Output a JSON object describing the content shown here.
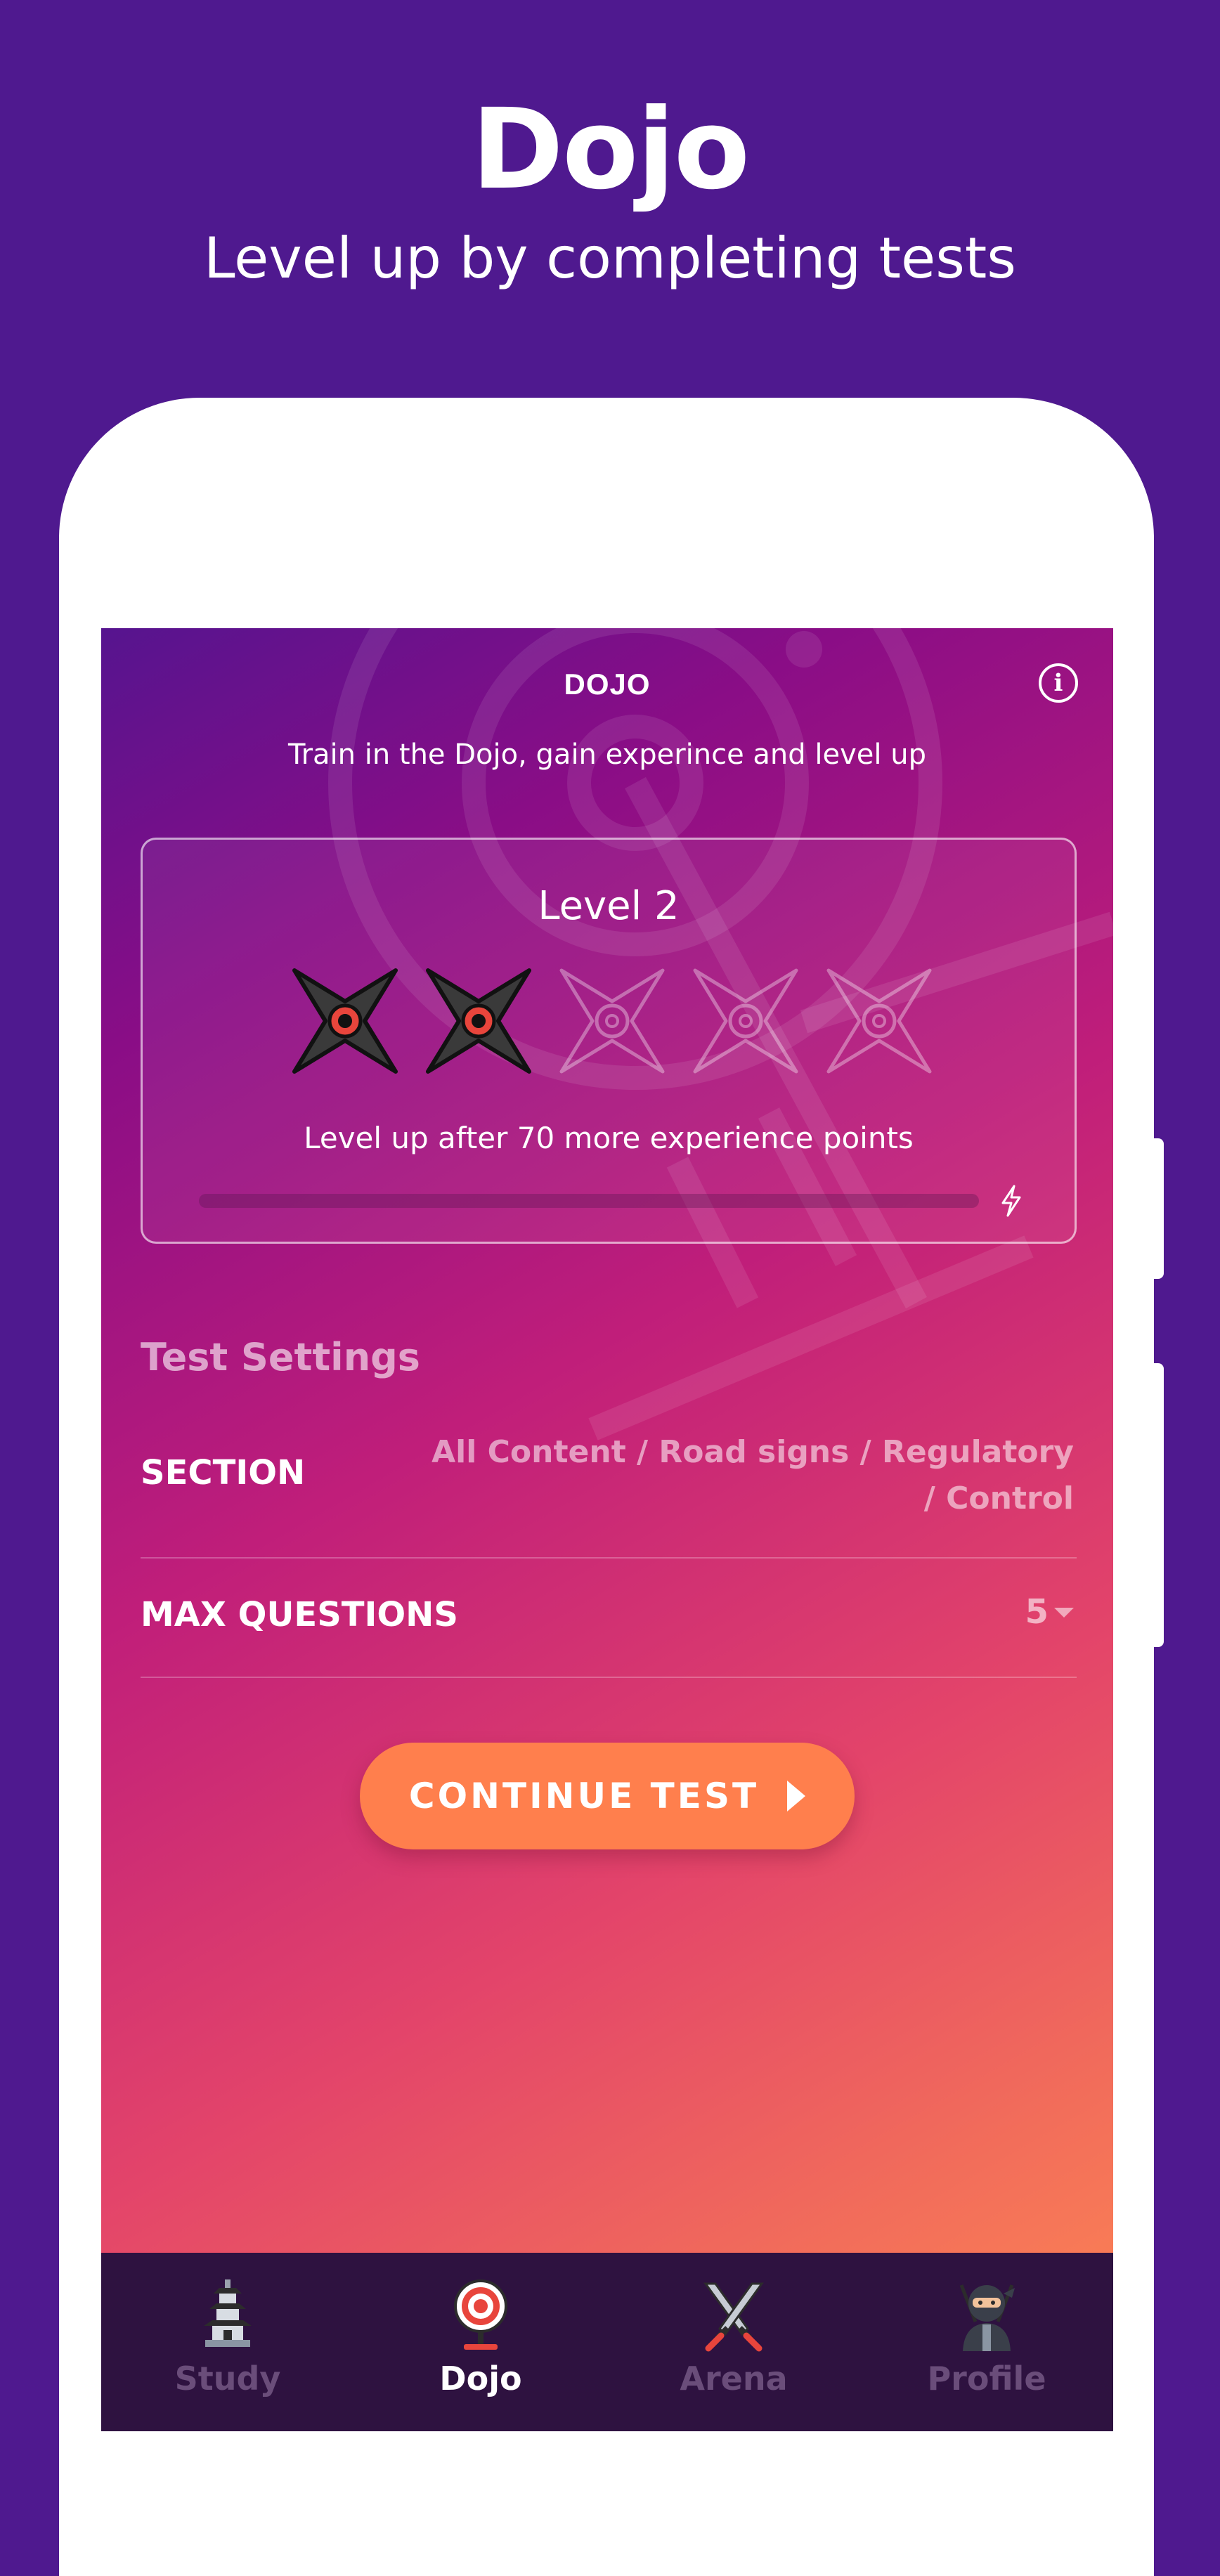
{
  "promo": {
    "title": "Dojo",
    "subtitle": "Level up by completing tests"
  },
  "screen": {
    "title": "DOJO",
    "info_icon": "info-icon",
    "subtitle": "Train in the Dojo, gain experince and level up"
  },
  "level_card": {
    "title": "Level 2",
    "stars_total": 5,
    "stars_earned": 2,
    "message": "Level up after 70 more experience points",
    "progress_fraction": 0.0
  },
  "settings": {
    "heading": "Test Settings",
    "section_label": "SECTION",
    "section_value": "All Content / Road signs / Regulatory / Control",
    "max_questions_label": "MAX QUESTIONS",
    "max_questions_value": "5"
  },
  "continue_button": {
    "label": "CONTINUE TEST"
  },
  "nav": {
    "items": [
      {
        "label": "Study",
        "icon": "pagoda-icon",
        "active": false
      },
      {
        "label": "Dojo",
        "icon": "target-icon",
        "active": true
      },
      {
        "label": "Arena",
        "icon": "crossed-swords-icon",
        "active": false
      },
      {
        "label": "Profile",
        "icon": "ninja-icon",
        "active": false
      }
    ]
  },
  "colors": {
    "background": "#4f198f",
    "accent": "#ff7f4d",
    "nav_bg": "#2e1240",
    "star_fill": "#3a3a3a",
    "star_center": "#e8453c"
  }
}
